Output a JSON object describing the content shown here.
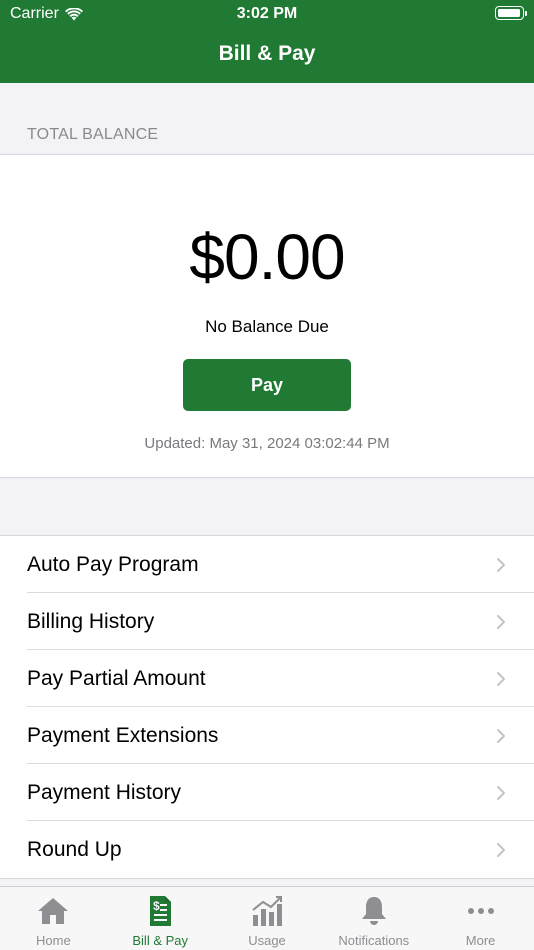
{
  "status_bar": {
    "carrier": "Carrier",
    "time": "3:02 PM"
  },
  "header": {
    "title": "Bill & Pay"
  },
  "balance": {
    "section_label": "TOTAL BALANCE",
    "amount": "$0.00",
    "status": "No Balance Due",
    "pay_label": "Pay",
    "updated": "Updated: May 31, 2024 03:02:44 PM"
  },
  "menu": {
    "items": [
      {
        "label": "Auto Pay Program"
      },
      {
        "label": "Billing History"
      },
      {
        "label": "Pay Partial Amount"
      },
      {
        "label": "Payment Extensions"
      },
      {
        "label": "Payment History"
      },
      {
        "label": "Round Up"
      }
    ]
  },
  "tabs": {
    "items": [
      {
        "label": "Home",
        "icon": "home-icon"
      },
      {
        "label": "Bill & Pay",
        "icon": "bill-icon",
        "active": true
      },
      {
        "label": "Usage",
        "icon": "usage-chart-icon"
      },
      {
        "label": "Notifications",
        "icon": "bell-icon"
      },
      {
        "label": "More",
        "icon": "more-dots-icon"
      }
    ]
  },
  "colors": {
    "brand_green": "#207a34",
    "inactive_tab": "#8e8e93",
    "background": "#f2f2f7"
  }
}
